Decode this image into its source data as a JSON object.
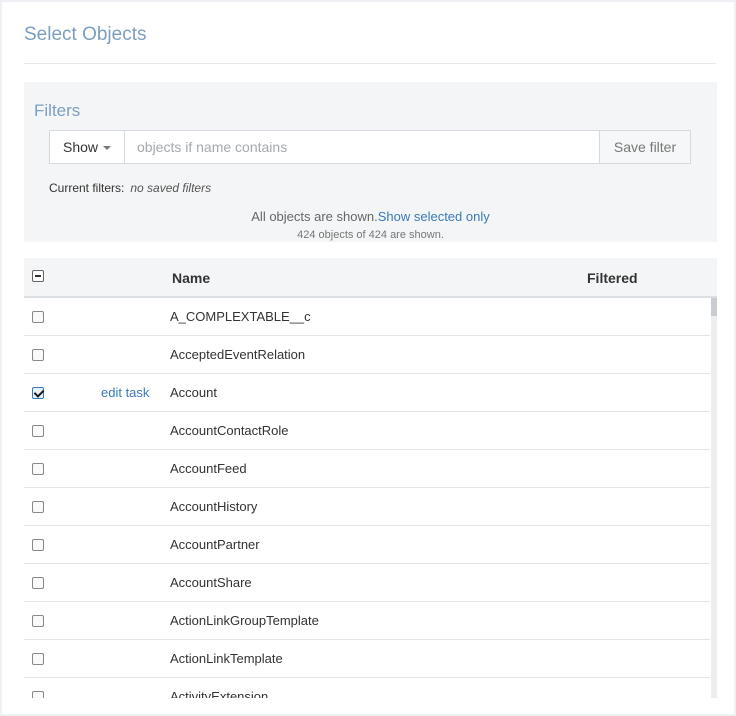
{
  "page": {
    "title": "Select Objects"
  },
  "filters": {
    "heading": "Filters",
    "show_label": "Show",
    "input_placeholder": "objects if name contains",
    "input_value": "",
    "save_label": "Save filter",
    "current_label": "Current filters:",
    "current_value": "no saved filters",
    "shown_text": "All objects are shown.",
    "show_selected_link": "Show selected only",
    "count_text": "424 objects of 424 are shown."
  },
  "table": {
    "columns": {
      "name": "Name",
      "filtered": "Filtered"
    },
    "rows": [
      {
        "name": "A_COMPLEXTABLE__c",
        "checked": false,
        "edit": ""
      },
      {
        "name": "AcceptedEventRelation",
        "checked": false,
        "edit": ""
      },
      {
        "name": "Account",
        "checked": true,
        "edit": "edit task"
      },
      {
        "name": "AccountContactRole",
        "checked": false,
        "edit": ""
      },
      {
        "name": "AccountFeed",
        "checked": false,
        "edit": ""
      },
      {
        "name": "AccountHistory",
        "checked": false,
        "edit": ""
      },
      {
        "name": "AccountPartner",
        "checked": false,
        "edit": ""
      },
      {
        "name": "AccountShare",
        "checked": false,
        "edit": ""
      },
      {
        "name": "ActionLinkGroupTemplate",
        "checked": false,
        "edit": ""
      },
      {
        "name": "ActionLinkTemplate",
        "checked": false,
        "edit": ""
      },
      {
        "name": "ActivityExtension",
        "checked": false,
        "edit": ""
      }
    ]
  }
}
